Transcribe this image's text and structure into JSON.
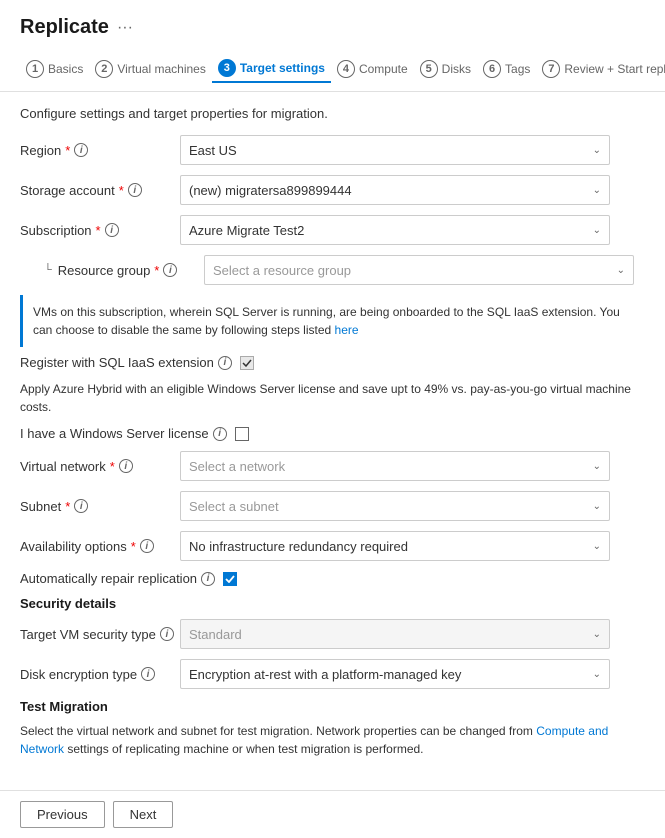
{
  "header": {
    "title": "Replicate",
    "ellipsis": "···"
  },
  "wizard": {
    "steps": [
      {
        "num": "1",
        "label": "Basics",
        "active": false
      },
      {
        "num": "2",
        "label": "Virtual machines",
        "active": false
      },
      {
        "num": "3",
        "label": "Target settings",
        "active": true
      },
      {
        "num": "4",
        "label": "Compute",
        "active": false
      },
      {
        "num": "5",
        "label": "Disks",
        "active": false
      },
      {
        "num": "6",
        "label": "Tags",
        "active": false
      },
      {
        "num": "7",
        "label": "Review + Start replication",
        "active": false
      }
    ]
  },
  "form": {
    "description": "Configure settings and target properties for migration.",
    "region": {
      "label": "Region",
      "required": true,
      "value": "East US"
    },
    "storage_account": {
      "label": "Storage account",
      "required": true,
      "value": "(new) migratersa899899444"
    },
    "subscription": {
      "label": "Subscription",
      "required": true,
      "value": "Azure Migrate Test2"
    },
    "resource_group": {
      "label": "Resource group",
      "required": true,
      "placeholder": "Select a resource group"
    },
    "sql_info": {
      "text": "VMs on this subscription, wherein SQL Server is running, are being onboarded to the SQL IaaS extension. You can choose to disable the same by following steps listed",
      "link_text": "here"
    },
    "register_sql": {
      "label": "Register with SQL IaaS extension"
    },
    "hybrid_text": "Apply Azure Hybrid with an eligible Windows Server license and save upt to 49% vs. pay-as-you-go virtual machine costs.",
    "windows_license": {
      "label": "I have a Windows Server license"
    },
    "virtual_network": {
      "label": "Virtual network",
      "required": true,
      "placeholder": "Select a network"
    },
    "subnet": {
      "label": "Subnet",
      "required": true,
      "placeholder": "Select a subnet"
    },
    "availability_options": {
      "label": "Availability options",
      "required": true,
      "value": "No infrastructure redundancy required"
    },
    "auto_repair": {
      "label": "Automatically repair replication",
      "checked": true
    },
    "security_details": {
      "title": "Security details"
    },
    "target_vm_security": {
      "label": "Target VM security type",
      "placeholder": "Standard"
    },
    "disk_encryption": {
      "label": "Disk encryption type",
      "value": "Encryption at-rest with a platform-managed key"
    },
    "test_migration": {
      "title": "Test Migration",
      "text": "Select the virtual network and subnet for test migration. Network properties can be changed from Compute and Network settings of replicating machine or when test migration is performed.",
      "link_text1": "Compute and Network",
      "link_text2": ""
    }
  },
  "footer": {
    "previous_label": "Previous",
    "next_label": "Next"
  }
}
